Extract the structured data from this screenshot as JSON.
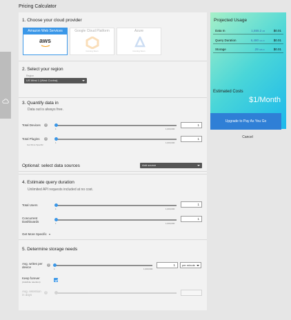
{
  "app": {
    "title": "Pricing Calculator"
  },
  "section1": {
    "heading": "1. Choose your cloud provider",
    "providers": [
      {
        "name": "Amazon Web Services",
        "logo": "aws",
        "selected": true
      },
      {
        "name": "Google Cloud Platform",
        "soon": "Coming Soon",
        "selected": false
      },
      {
        "name": "Azure",
        "soon": "Coming Soon",
        "selected": false
      }
    ]
  },
  "section2": {
    "heading": "2. Select your region",
    "region_label": "Region",
    "region_value": "US West 1 (West Covina)"
  },
  "section3": {
    "heading": "3. Quantify data in",
    "subtitle": "Data out is always free.",
    "devices": {
      "label": "Total Devices",
      "min": "1",
      "max": "1,000,000",
      "value": "1"
    },
    "plugins": {
      "label": "Total Plugins",
      "link": "Get More Specific",
      "min": "1",
      "max": "1,000,000",
      "value": "1"
    }
  },
  "optional": {
    "heading": "Optional: select data sources",
    "select_placeholder": "Add source"
  },
  "section4": {
    "heading": "4. Estimate query duration",
    "subtitle": "Unlimited API requests included at no cost.",
    "users": {
      "label": "Total Users",
      "min": "1",
      "max": "1,000,000",
      "value": "1"
    },
    "dashboards": {
      "label": "Concurrent Dashboards",
      "min": "1",
      "max": "1,000,000",
      "value": "1"
    },
    "more_link": "Get More Specific"
  },
  "section5": {
    "heading": "5. Determine storage needs",
    "writes": {
      "label": "Avg. writes per device",
      "min": "1",
      "max": "1,000,000",
      "value": "1",
      "unit": "per minute"
    },
    "keep": {
      "label": "Keep forever",
      "sub": "(indefinite retention)",
      "checked": true
    },
    "retention": {
      "label": "Avg. retention in days"
    }
  },
  "usage": {
    "heading": "Projected Usage",
    "rows": [
      {
        "name": "Data In",
        "value": "1,555.2",
        "unit": "kB",
        "price": "$0.01"
      },
      {
        "name": "Query Duration",
        "value": "6,480",
        "unit": "Gb-hr",
        "price": "$0.01"
      },
      {
        "name": "Storage",
        "value": ".29",
        "unit": "GB-hr",
        "price": "$0.01"
      }
    ],
    "estimated_label": "Estimated Costs",
    "price": "$1/Month"
  },
  "actions": {
    "upgrade": "Upgrade to Pay As You Go",
    "cancel": "Cancel"
  },
  "colors": {
    "accent": "#3a97e8",
    "button": "#2f7fd6"
  }
}
